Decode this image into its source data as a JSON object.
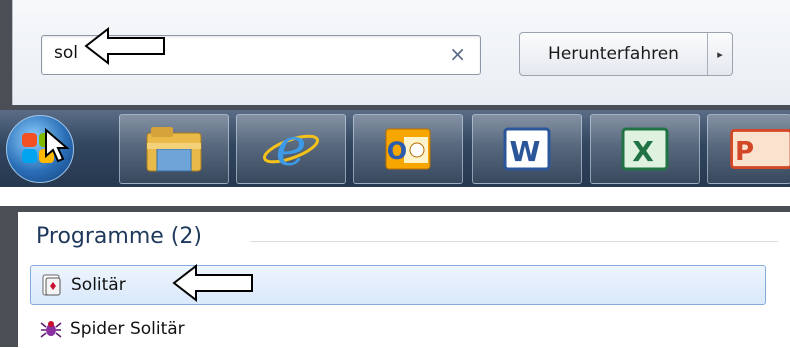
{
  "search": {
    "value": "sol",
    "clear_glyph": "×"
  },
  "shutdown": {
    "label": "Herunterfahren",
    "arrow_glyph": "▸"
  },
  "taskbar": {
    "items": [
      {
        "name": "start-orb",
        "icon": "windows-logo-icon"
      },
      {
        "name": "explorer",
        "icon": "folder-icon"
      },
      {
        "name": "internet-explorer",
        "icon": "internet-explorer-icon",
        "glyph": "e"
      },
      {
        "name": "outlook",
        "icon": "outlook-icon",
        "glyph": "O"
      },
      {
        "name": "word",
        "icon": "word-icon",
        "glyph": "W"
      },
      {
        "name": "excel",
        "icon": "excel-icon",
        "glyph": "X"
      },
      {
        "name": "powerpoint",
        "icon": "powerpoint-icon",
        "glyph": "P"
      }
    ]
  },
  "results": {
    "group_header": "Programme (2)",
    "items": [
      {
        "label": "Solitär",
        "icon": "solitaire-icon",
        "selected": true
      },
      {
        "label": "Spider Solitär",
        "icon": "spider-solitaire-icon",
        "selected": false
      }
    ]
  },
  "colors": {
    "header_blue": "#1e395b",
    "selection_border": "#84acdd",
    "taskbar_dark": "#26384f"
  }
}
